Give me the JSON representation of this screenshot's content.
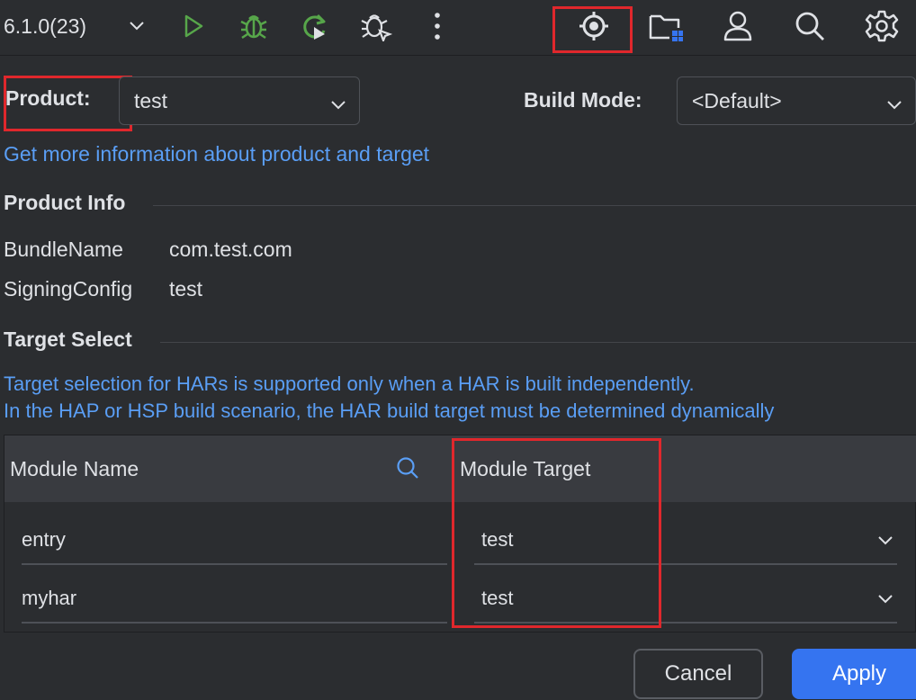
{
  "toolbar": {
    "version_label": "6.1.0(23)",
    "icons": [
      "chevron-down-icon",
      "run-icon",
      "debug-icon",
      "reload-icon",
      "attach-debugger-icon",
      "more-vertical-icon",
      "target-icon",
      "project-folder-icon",
      "account-icon",
      "search-icon",
      "settings-icon"
    ]
  },
  "product": {
    "label": "Product:",
    "value": "test"
  },
  "build_mode": {
    "label": "Build Mode:",
    "value": "<Default>"
  },
  "help_link": "Get more information about product and target",
  "product_info": {
    "title": "Product Info",
    "rows": [
      {
        "key": "BundleName",
        "value": "com.test.com"
      },
      {
        "key": "SigningConfig",
        "value": "test"
      }
    ]
  },
  "target_select": {
    "title": "Target Select",
    "info_lines": [
      "Target selection for HARs is supported only when a HAR is built independently.",
      "In the HAP or HSP build scenario, the HAR build target must be determined dynamically"
    ]
  },
  "table": {
    "columns": [
      "Module Name",
      "Module Target"
    ],
    "rows": [
      {
        "module": "entry",
        "target": "test"
      },
      {
        "module": "myhar",
        "target": "test"
      }
    ]
  },
  "footer": {
    "cancel_label": "Cancel",
    "apply_label": "Apply"
  },
  "colors": {
    "background": "#2b2d30",
    "accent": "#3574f0",
    "link": "#5a9ef5",
    "highlight": "#e0272c",
    "run_green": "#57a64a"
  }
}
